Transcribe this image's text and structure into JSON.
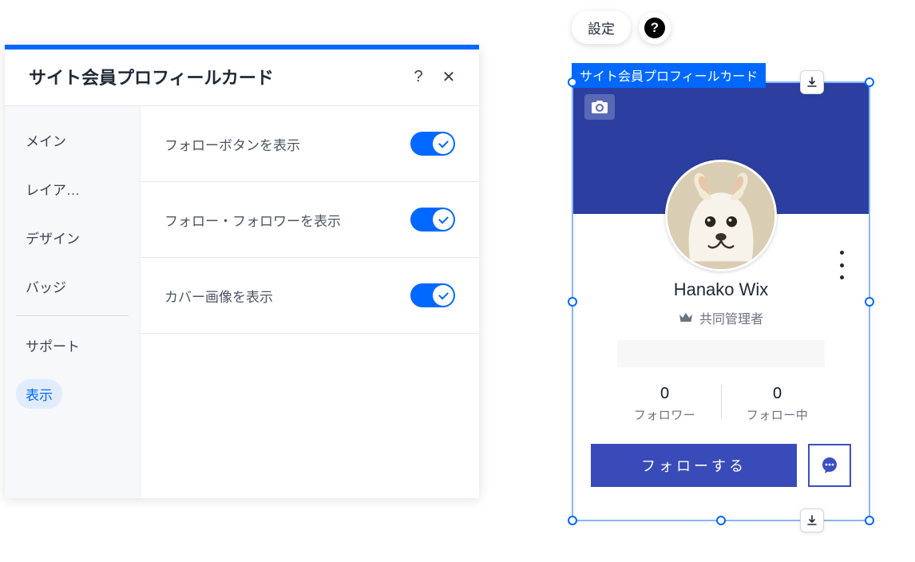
{
  "panel": {
    "title": "サイト会員プロフィールカード",
    "help_glyph": "?",
    "close_glyph": "✕",
    "sidebar": {
      "items": [
        {
          "label": "メイン"
        },
        {
          "label": "レイア…"
        },
        {
          "label": "デザイン"
        },
        {
          "label": "バッジ"
        }
      ],
      "support_label": "サポート",
      "display_label": "表示"
    },
    "settings": [
      {
        "label": "フォローボタンを表示",
        "on": true
      },
      {
        "label": "フォロー・フォロワーを表示",
        "on": true
      },
      {
        "label": "カバー画像を表示",
        "on": true
      }
    ]
  },
  "floating": {
    "settings_label": "設定",
    "help_glyph": "?"
  },
  "preview": {
    "component_label": "サイト会員プロフィールカード",
    "display_name": "Hanako Wix",
    "role_label": "共同管理者",
    "followers": {
      "count": "0",
      "label": "フォロワー"
    },
    "following": {
      "count": "0",
      "label": "フォロー中"
    },
    "follow_button": "フォローする"
  },
  "colors": {
    "accent": "#0068ff",
    "cover": "#2c3fa0",
    "follow_btn": "#384bb8"
  }
}
